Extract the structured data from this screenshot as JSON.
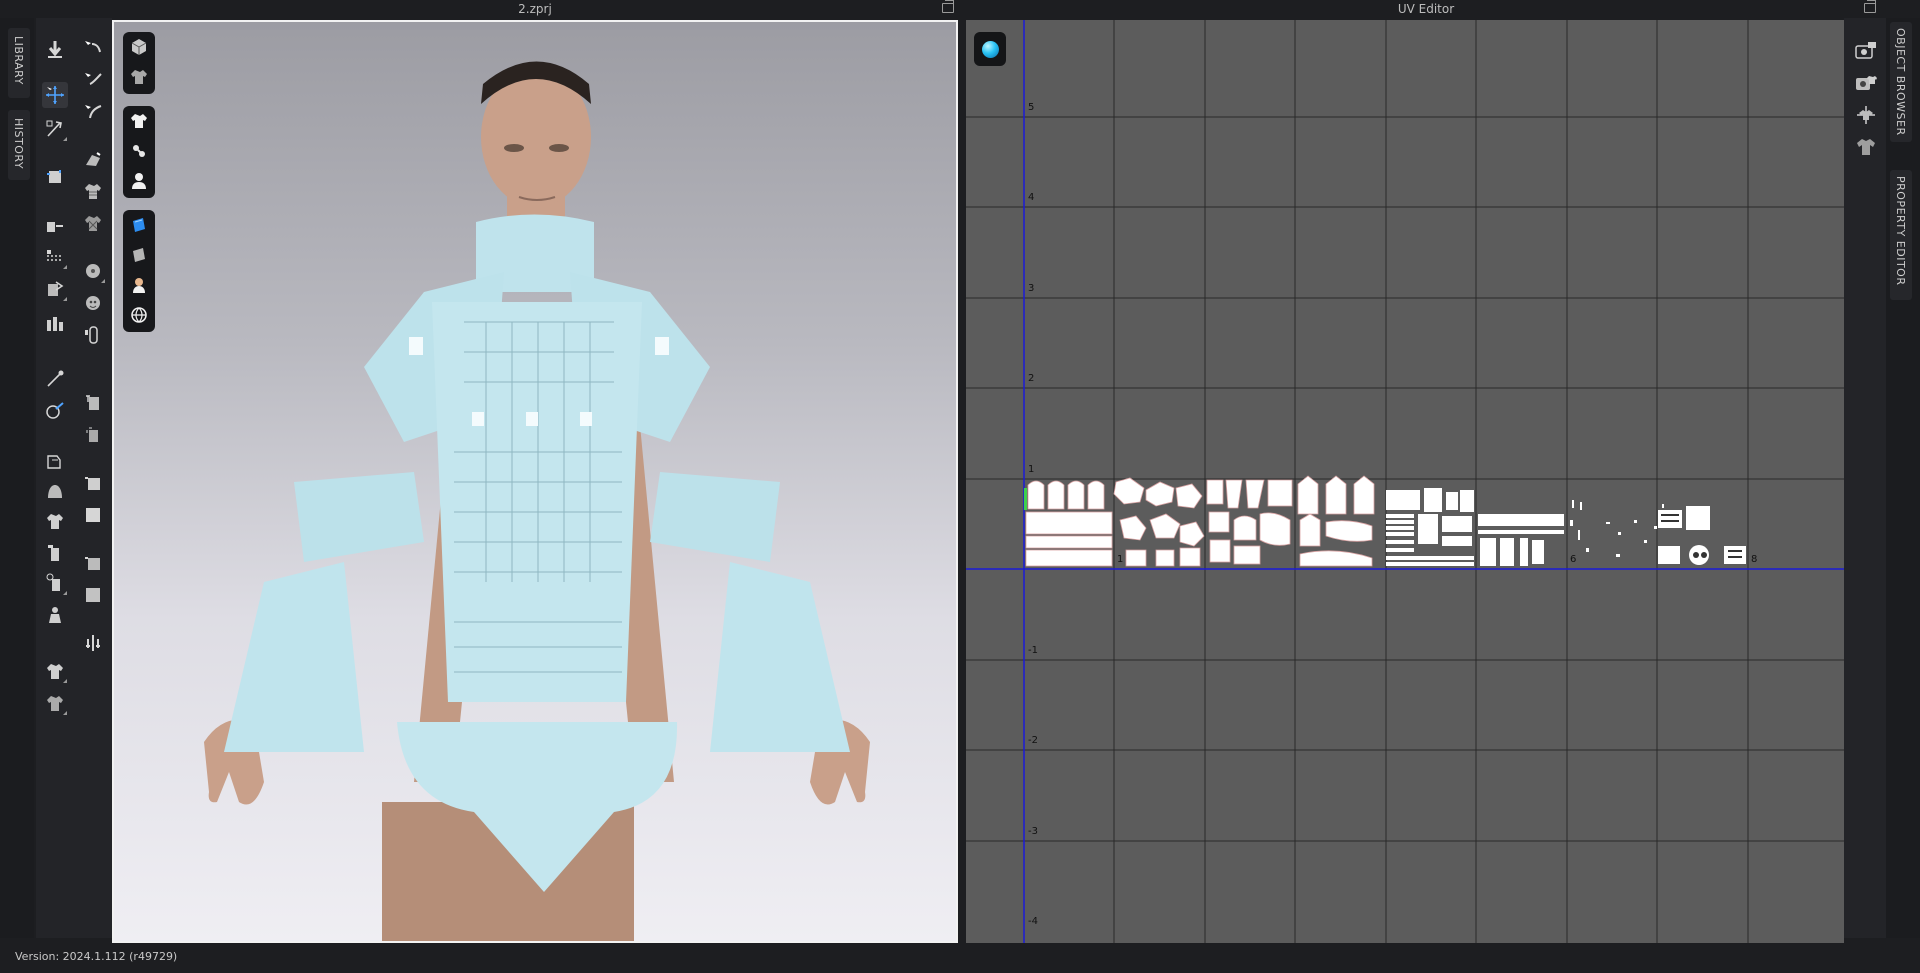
{
  "left_tabs": [
    "LIBRARY",
    "HISTORY"
  ],
  "right_tabs": [
    "OBJECT BROWSER",
    "PROPERTY EDITOR"
  ],
  "viewport": {
    "title": "2.zprj",
    "float_button": "float-window-icon",
    "toolbar_groups": [
      [
        "cube-icon",
        "garment-display-icon"
      ],
      [
        "shirt-icon",
        "hanger-icon",
        "avatar-icon"
      ],
      [
        "texture-icon",
        "surface-icon",
        "avatar-head-icon",
        "globe-icon"
      ]
    ]
  },
  "uv_editor": {
    "title": "UV Editor",
    "float_button": "float-window-icon",
    "y_labels": [
      "5",
      "4",
      "3",
      "2",
      "1",
      "-1",
      "-2",
      "-3",
      "-4"
    ],
    "tile_labels": [
      "1",
      "6",
      "8"
    ],
    "colors": {
      "background": "#5c5c5c",
      "axis": "#1b1bd6",
      "uv_shells": "#ffffff",
      "seam": "#d9a3a3"
    }
  },
  "tools": {
    "col1": [
      "simulate-icon",
      "select-move-icon",
      "transform-pattern-icon",
      "edit-pattern-icon",
      "segment-icon",
      "sew-line-icon",
      "fold-arrangement-icon",
      "tack-icon",
      "pin-icon",
      "brush-icon",
      "puckering-icon",
      "hood-icon",
      "garment-icon",
      "avatar-measure-icon",
      "avatar-pose-icon",
      "fit-garment-icon",
      "arrange-icon"
    ],
    "col2": [
      "point-select-icon",
      "line-select-icon",
      "curve-select-icon",
      "drape-icon",
      "fabric-icon",
      "texture-icon",
      "button-icon",
      "buttonhole-icon",
      "zipper-icon",
      "trim-icon",
      "stitch-icon",
      "topstitch-icon",
      "rectangle-icon",
      "square-icon",
      "dark-square-icon",
      "gray-square-icon",
      "adjust-icon"
    ]
  },
  "right_panel_icons": [
    "camera-icon",
    "camera-shirt-icon",
    "move-shirt-icon",
    "shirt-gray-icon"
  ],
  "status": {
    "version": "Version: 2024.1.112 (r49729)"
  }
}
